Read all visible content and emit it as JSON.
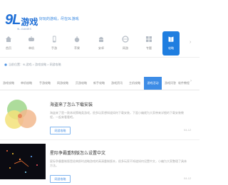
{
  "header": {
    "logo_number": "9L",
    "logo_text": "游戏",
    "logo_sub": "9L.GAMES",
    "slogan": "好玩的游戏，尽在9L游戏"
  },
  "nav": {
    "items": [
      {
        "label": "首页",
        "icon": "home-icon"
      },
      {
        "label": "单机",
        "icon": "gamepad-icon"
      },
      {
        "label": "手游",
        "icon": "phone-icon"
      },
      {
        "label": "苹果",
        "icon": "apple-icon"
      },
      {
        "label": "安卓",
        "icon": "android-icon"
      },
      {
        "label": "网游",
        "icon": "globe-icon"
      },
      {
        "label": "专题",
        "icon": "grid-icon"
      },
      {
        "label": "攻略",
        "icon": "book-icon"
      }
    ]
  },
  "breadcrumb": {
    "path": "当前位置：9L游戏 > 游戏攻略 > 网游攻略"
  },
  "tabs": [
    "游戏攻略",
    "单机攻略",
    "手游攻略",
    "网游攻略",
    "页游攻略",
    "新手攻略",
    "游戏资讯",
    "主机攻略",
    "游戏活动",
    "游戏问答",
    "软件教程"
  ],
  "articles": [
    {
      "title": "海盗来了怎么下载安装",
      "desc": "海盗来了是一款休闲策略类游戏，很多玩家想知道如何下载安装，下面小编就为大家带来详细的下载安装教程，一起来看看吧。",
      "tag": "网游攻略",
      "date": "04-12"
    },
    {
      "title": "星际争霸重制版怎么设置中文",
      "desc": "星际争霸重制版是经典即时战略游戏的高清重制版本，很多玩家不知道如何设置中文，小编为大家整理了具体方法。",
      "tag": "网游攻略",
      "date": "04-12"
    }
  ],
  "colors": {
    "accent": "#1f7ee0",
    "tab_active": "#3d8ce6",
    "logo": "#1f6fd6"
  }
}
